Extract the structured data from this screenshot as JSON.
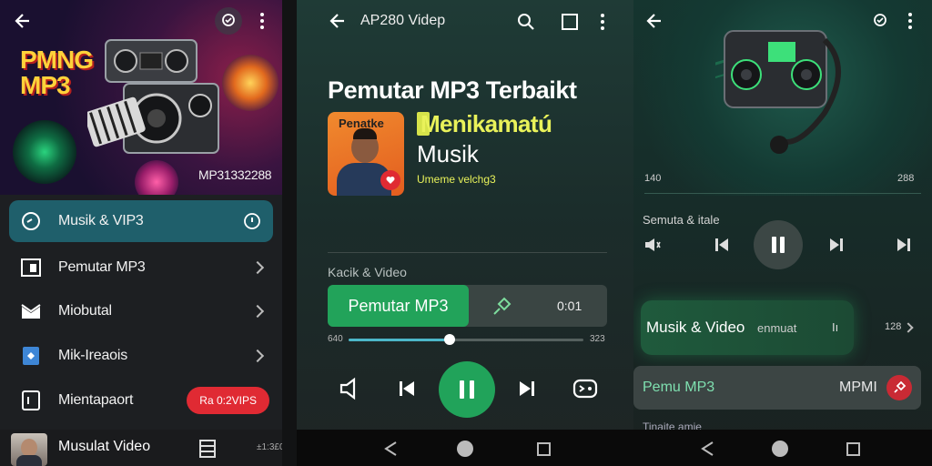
{
  "screen1": {
    "hero_brand_line1": "PMNG",
    "hero_brand_line2": "MP3",
    "hero_code": "MP31332288",
    "menu": [
      {
        "label": "Musik & VIP3"
      },
      {
        "label": "Pemutar MP3"
      },
      {
        "label": "Miobutal"
      },
      {
        "label": "Mik-Ireaois"
      },
      {
        "label": "Mientapaort",
        "badge": "Ra 0:2VIPS"
      }
    ],
    "now_playing": {
      "title": "Musulat Video",
      "time": "±1:3£0"
    }
  },
  "screen2": {
    "header_title": "AP280 Videp",
    "headline": "Pemutar MP3 Terbaikt",
    "thumb_label": "Penatke",
    "feature_line1": "Menikamatú",
    "feature_line2": "Musik",
    "feature_sub": "Umeme velchg3",
    "section_label": "Kacik & Video",
    "primary_button": "Pemutar MP3",
    "time_value": "0:01",
    "progress": {
      "start": "640",
      "end": "323",
      "fraction": 0.43
    }
  },
  "screen3": {
    "time_left": "140",
    "time_right": "288",
    "track_label": "Semuta & itale",
    "card1_title": "Musik & Video",
    "card1_sub": "enmuat",
    "card1_tag": "Iı",
    "card1_count": "128",
    "card2_title": "Pemu MP3",
    "card2_tag": "MPMI",
    "footer_text": "Tinaite amie"
  },
  "colors": {
    "accent_green": "#22a35a",
    "active_teal": "#1f5f6b",
    "badge_red": "#e02a33"
  }
}
